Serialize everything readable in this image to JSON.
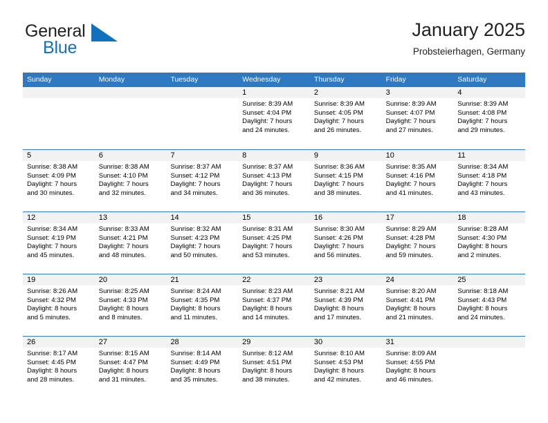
{
  "brand": {
    "name_top": "General",
    "name_bottom": "Blue",
    "accent_color": "#1271bf"
  },
  "header": {
    "title": "January 2025",
    "location": "Probsteierhagen, Germany"
  },
  "calendar": {
    "header_color": "#2e79c1",
    "weekdays": [
      "Sunday",
      "Monday",
      "Tuesday",
      "Wednesday",
      "Thursday",
      "Friday",
      "Saturday"
    ],
    "labels": {
      "sunrise": "Sunrise:",
      "sunset": "Sunset:",
      "daylight": "Daylight:"
    },
    "weeks": [
      [
        {
          "day": "",
          "empty": true
        },
        {
          "day": "",
          "empty": true
        },
        {
          "day": "",
          "empty": true
        },
        {
          "day": "1",
          "sunrise": "Sunrise: 8:39 AM",
          "sunset": "Sunset: 4:04 PM",
          "daylight_line1": "Daylight: 7 hours",
          "daylight_line2": "and 24 minutes."
        },
        {
          "day": "2",
          "sunrise": "Sunrise: 8:39 AM",
          "sunset": "Sunset: 4:05 PM",
          "daylight_line1": "Daylight: 7 hours",
          "daylight_line2": "and 26 minutes."
        },
        {
          "day": "3",
          "sunrise": "Sunrise: 8:39 AM",
          "sunset": "Sunset: 4:07 PM",
          "daylight_line1": "Daylight: 7 hours",
          "daylight_line2": "and 27 minutes."
        },
        {
          "day": "4",
          "sunrise": "Sunrise: 8:39 AM",
          "sunset": "Sunset: 4:08 PM",
          "daylight_line1": "Daylight: 7 hours",
          "daylight_line2": "and 29 minutes."
        }
      ],
      [
        {
          "day": "5",
          "sunrise": "Sunrise: 8:38 AM",
          "sunset": "Sunset: 4:09 PM",
          "daylight_line1": "Daylight: 7 hours",
          "daylight_line2": "and 30 minutes."
        },
        {
          "day": "6",
          "sunrise": "Sunrise: 8:38 AM",
          "sunset": "Sunset: 4:10 PM",
          "daylight_line1": "Daylight: 7 hours",
          "daylight_line2": "and 32 minutes."
        },
        {
          "day": "7",
          "sunrise": "Sunrise: 8:37 AM",
          "sunset": "Sunset: 4:12 PM",
          "daylight_line1": "Daylight: 7 hours",
          "daylight_line2": "and 34 minutes."
        },
        {
          "day": "8",
          "sunrise": "Sunrise: 8:37 AM",
          "sunset": "Sunset: 4:13 PM",
          "daylight_line1": "Daylight: 7 hours",
          "daylight_line2": "and 36 minutes."
        },
        {
          "day": "9",
          "sunrise": "Sunrise: 8:36 AM",
          "sunset": "Sunset: 4:15 PM",
          "daylight_line1": "Daylight: 7 hours",
          "daylight_line2": "and 38 minutes."
        },
        {
          "day": "10",
          "sunrise": "Sunrise: 8:35 AM",
          "sunset": "Sunset: 4:16 PM",
          "daylight_line1": "Daylight: 7 hours",
          "daylight_line2": "and 41 minutes."
        },
        {
          "day": "11",
          "sunrise": "Sunrise: 8:34 AM",
          "sunset": "Sunset: 4:18 PM",
          "daylight_line1": "Daylight: 7 hours",
          "daylight_line2": "and 43 minutes."
        }
      ],
      [
        {
          "day": "12",
          "sunrise": "Sunrise: 8:34 AM",
          "sunset": "Sunset: 4:19 PM",
          "daylight_line1": "Daylight: 7 hours",
          "daylight_line2": "and 45 minutes."
        },
        {
          "day": "13",
          "sunrise": "Sunrise: 8:33 AM",
          "sunset": "Sunset: 4:21 PM",
          "daylight_line1": "Daylight: 7 hours",
          "daylight_line2": "and 48 minutes."
        },
        {
          "day": "14",
          "sunrise": "Sunrise: 8:32 AM",
          "sunset": "Sunset: 4:23 PM",
          "daylight_line1": "Daylight: 7 hours",
          "daylight_line2": "and 50 minutes."
        },
        {
          "day": "15",
          "sunrise": "Sunrise: 8:31 AM",
          "sunset": "Sunset: 4:25 PM",
          "daylight_line1": "Daylight: 7 hours",
          "daylight_line2": "and 53 minutes."
        },
        {
          "day": "16",
          "sunrise": "Sunrise: 8:30 AM",
          "sunset": "Sunset: 4:26 PM",
          "daylight_line1": "Daylight: 7 hours",
          "daylight_line2": "and 56 minutes."
        },
        {
          "day": "17",
          "sunrise": "Sunrise: 8:29 AM",
          "sunset": "Sunset: 4:28 PM",
          "daylight_line1": "Daylight: 7 hours",
          "daylight_line2": "and 59 minutes."
        },
        {
          "day": "18",
          "sunrise": "Sunrise: 8:28 AM",
          "sunset": "Sunset: 4:30 PM",
          "daylight_line1": "Daylight: 8 hours",
          "daylight_line2": "and 2 minutes."
        }
      ],
      [
        {
          "day": "19",
          "sunrise": "Sunrise: 8:26 AM",
          "sunset": "Sunset: 4:32 PM",
          "daylight_line1": "Daylight: 8 hours",
          "daylight_line2": "and 5 minutes."
        },
        {
          "day": "20",
          "sunrise": "Sunrise: 8:25 AM",
          "sunset": "Sunset: 4:33 PM",
          "daylight_line1": "Daylight: 8 hours",
          "daylight_line2": "and 8 minutes."
        },
        {
          "day": "21",
          "sunrise": "Sunrise: 8:24 AM",
          "sunset": "Sunset: 4:35 PM",
          "daylight_line1": "Daylight: 8 hours",
          "daylight_line2": "and 11 minutes."
        },
        {
          "day": "22",
          "sunrise": "Sunrise: 8:23 AM",
          "sunset": "Sunset: 4:37 PM",
          "daylight_line1": "Daylight: 8 hours",
          "daylight_line2": "and 14 minutes."
        },
        {
          "day": "23",
          "sunrise": "Sunrise: 8:21 AM",
          "sunset": "Sunset: 4:39 PM",
          "daylight_line1": "Daylight: 8 hours",
          "daylight_line2": "and 17 minutes."
        },
        {
          "day": "24",
          "sunrise": "Sunrise: 8:20 AM",
          "sunset": "Sunset: 4:41 PM",
          "daylight_line1": "Daylight: 8 hours",
          "daylight_line2": "and 21 minutes."
        },
        {
          "day": "25",
          "sunrise": "Sunrise: 8:18 AM",
          "sunset": "Sunset: 4:43 PM",
          "daylight_line1": "Daylight: 8 hours",
          "daylight_line2": "and 24 minutes."
        }
      ],
      [
        {
          "day": "26",
          "sunrise": "Sunrise: 8:17 AM",
          "sunset": "Sunset: 4:45 PM",
          "daylight_line1": "Daylight: 8 hours",
          "daylight_line2": "and 28 minutes."
        },
        {
          "day": "27",
          "sunrise": "Sunrise: 8:15 AM",
          "sunset": "Sunset: 4:47 PM",
          "daylight_line1": "Daylight: 8 hours",
          "daylight_line2": "and 31 minutes."
        },
        {
          "day": "28",
          "sunrise": "Sunrise: 8:14 AM",
          "sunset": "Sunset: 4:49 PM",
          "daylight_line1": "Daylight: 8 hours",
          "daylight_line2": "and 35 minutes."
        },
        {
          "day": "29",
          "sunrise": "Sunrise: 8:12 AM",
          "sunset": "Sunset: 4:51 PM",
          "daylight_line1": "Daylight: 8 hours",
          "daylight_line2": "and 38 minutes."
        },
        {
          "day": "30",
          "sunrise": "Sunrise: 8:10 AM",
          "sunset": "Sunset: 4:53 PM",
          "daylight_line1": "Daylight: 8 hours",
          "daylight_line2": "and 42 minutes."
        },
        {
          "day": "31",
          "sunrise": "Sunrise: 8:09 AM",
          "sunset": "Sunset: 4:55 PM",
          "daylight_line1": "Daylight: 8 hours",
          "daylight_line2": "and 46 minutes."
        },
        {
          "day": "",
          "empty": true
        }
      ]
    ]
  }
}
